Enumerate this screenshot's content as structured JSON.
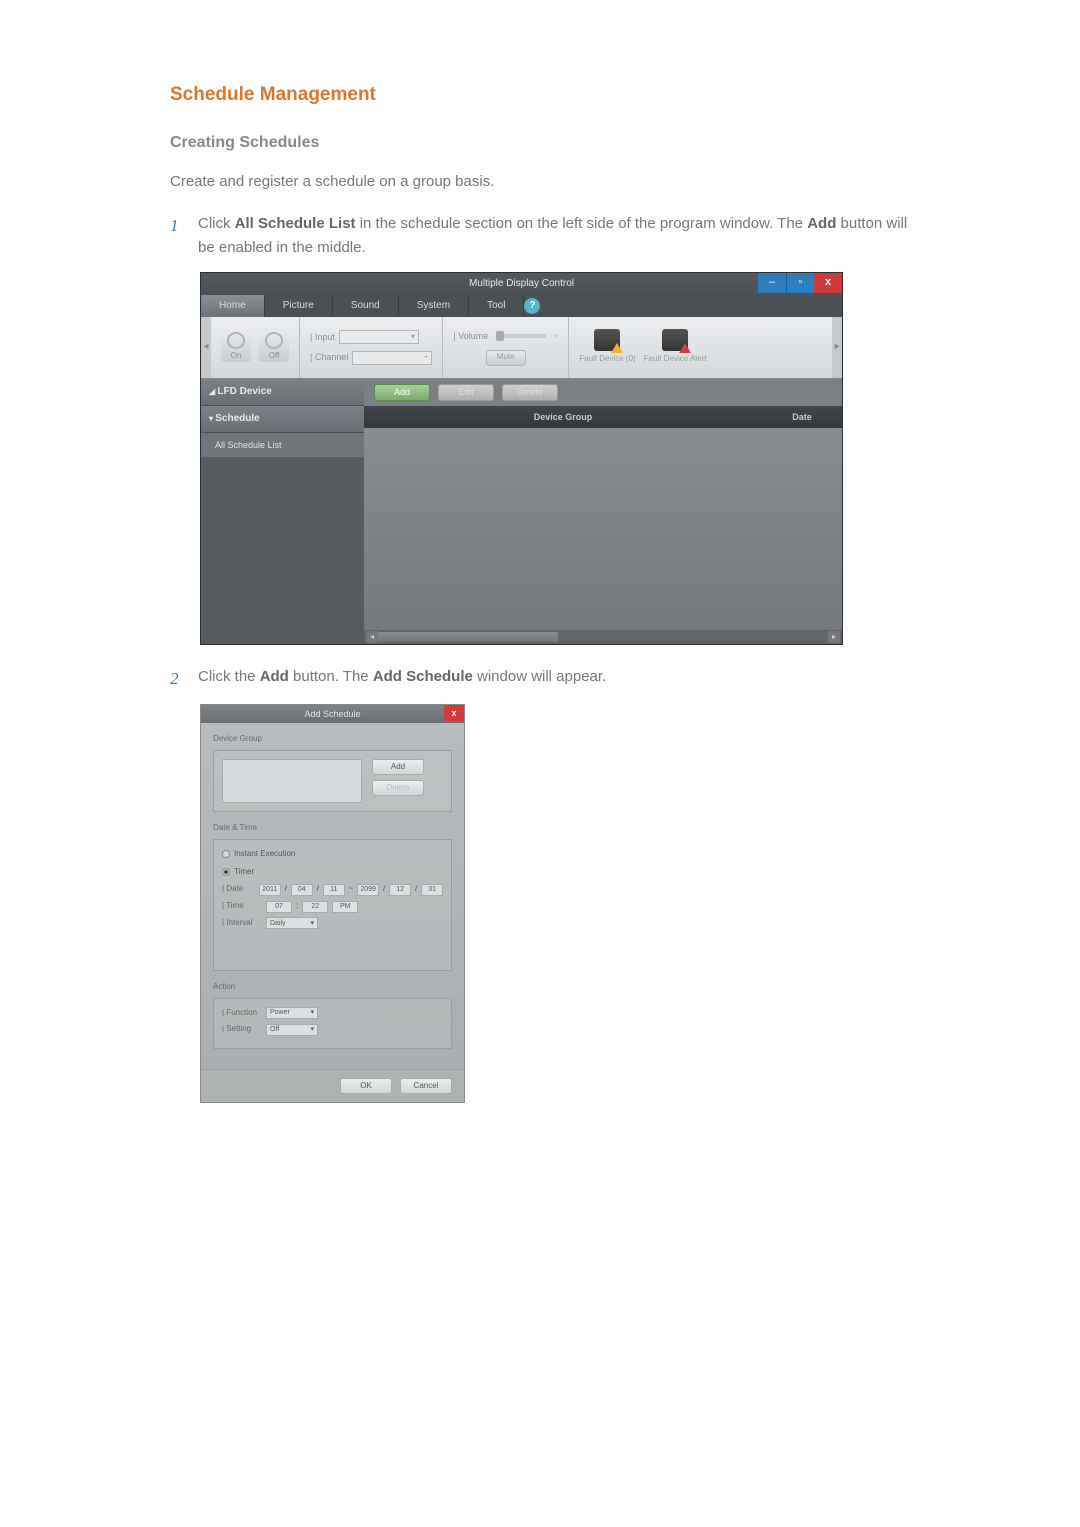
{
  "heading": "Schedule Management",
  "subheading": "Creating Schedules",
  "intro": "Create and register a schedule on a group basis.",
  "step1": {
    "num": "1",
    "pre": "Click ",
    "b1": "All Schedule List",
    "mid": " in the schedule section on the left side of the program window. The ",
    "b2": "Add",
    "post": " button will be enabled in the middle."
  },
  "step2": {
    "num": "2",
    "pre": "Click the ",
    "b1": "Add",
    "mid": " button. The ",
    "b2": "Add Schedule",
    "post": " window will appear."
  },
  "win": {
    "title": "Multiple Display Control",
    "tabs": [
      "Home",
      "Picture",
      "Sound",
      "System",
      "Tool"
    ],
    "help": "?",
    "power_on": "On",
    "power_off": "Off",
    "input": "| Input",
    "channel": "| Channel",
    "volume": "| Volume",
    "mute": "Mute",
    "fault_device": "Fault Device (0)",
    "fault_alert": "Fault Device Alert",
    "panel_lfd": "LFD Device",
    "panel_schedule": "Schedule",
    "all_schedule_list": "All Schedule List",
    "btn_add": "Add",
    "btn_edit": "Edit",
    "btn_delete": "Delete",
    "col_device_group": "Device Group",
    "col_date": "Date"
  },
  "dlg": {
    "title": "Add Schedule",
    "device_group": "Device Group",
    "add": "Add",
    "delete": "Delete",
    "date_time": "Date & Time",
    "instant": "Instant Execution",
    "timer": "Timer",
    "date_label": "| Date",
    "time_label": "| Time",
    "interval_label": "| Interval",
    "d_y1": "2011",
    "d_m1": "04",
    "d_d1": "11",
    "d_y2": "2099",
    "d_m2": "12",
    "d_d2": "31",
    "t_h": "07",
    "t_m": "22",
    "t_ap": "PM",
    "interval": "Daily",
    "action": "Action",
    "function_label": "| Function",
    "setting_label": "| Setting",
    "function_val": "Power",
    "setting_val": "Off",
    "ok": "OK",
    "cancel": "Cancel",
    "tilde": "~",
    "slash": "/",
    "dd": "▾",
    "spin": "÷"
  },
  "winctrl": {
    "min": "–",
    "max": "▫",
    "close": "x"
  }
}
